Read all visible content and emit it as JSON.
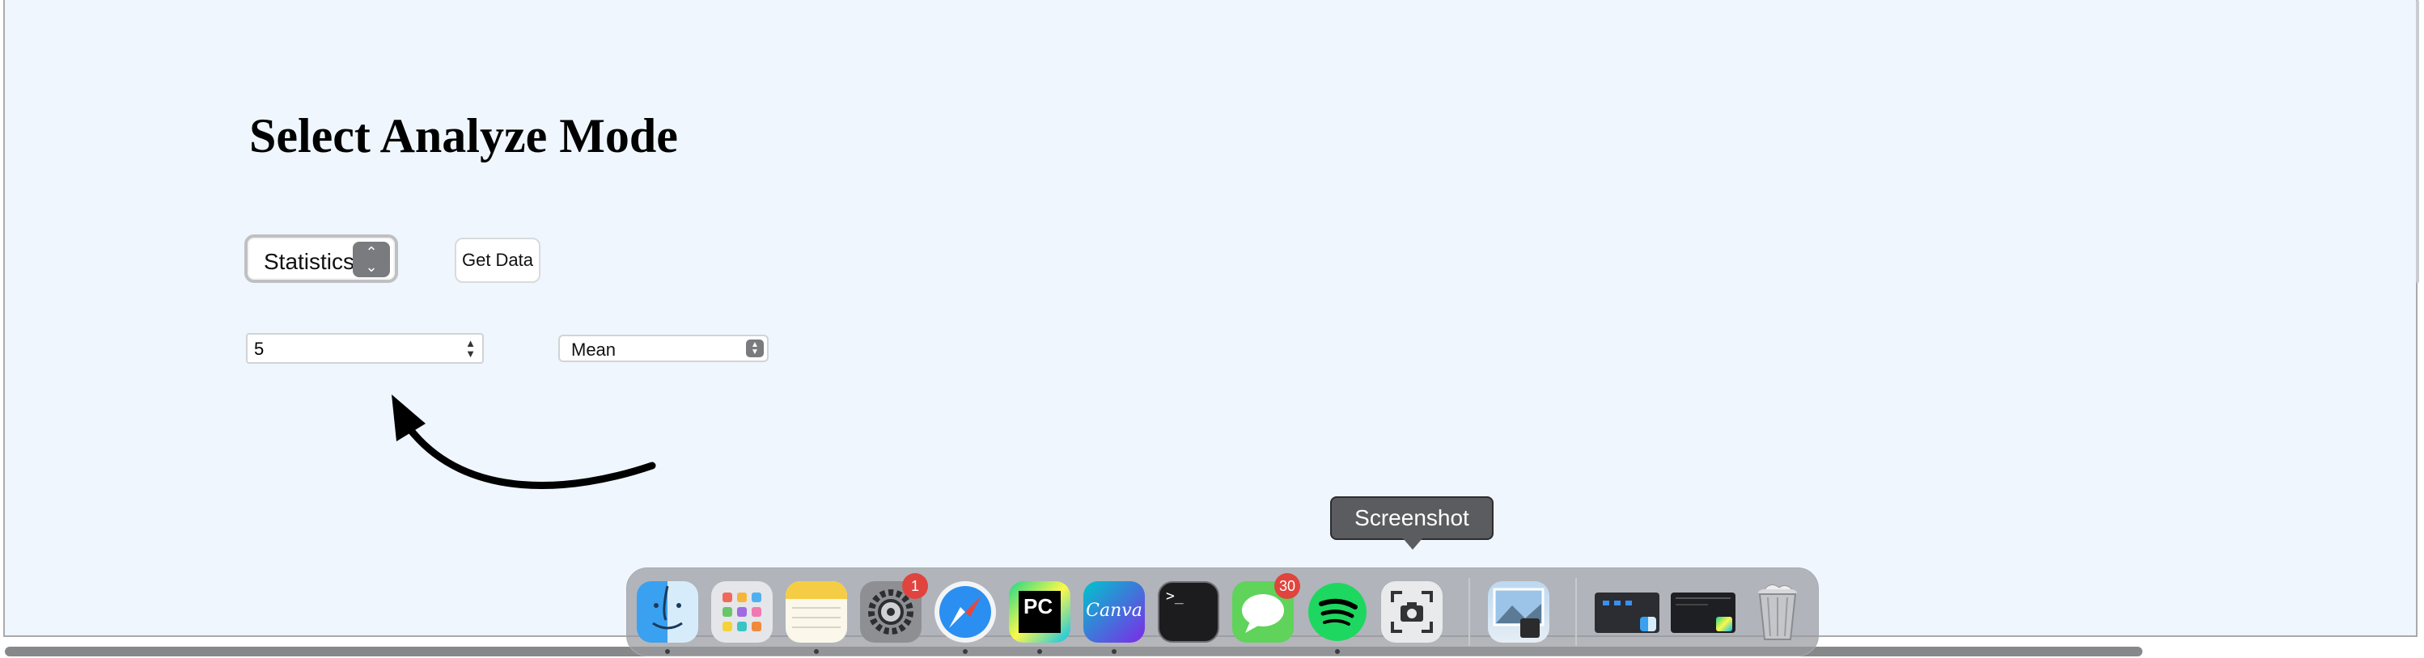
{
  "page": {
    "title": "Select Analyze Mode",
    "mode_select": {
      "value": "Statistics"
    },
    "get_data_label": "Get Data",
    "number_input": {
      "value": "5"
    },
    "statistic_select": {
      "value": "Mean"
    }
  },
  "dock": {
    "tooltip": "Screenshot",
    "apps": [
      {
        "name": "Finder",
        "icon": "finder-icon",
        "running": true
      },
      {
        "name": "Launchpad",
        "icon": "launchpad-icon",
        "running": false
      },
      {
        "name": "Notes",
        "icon": "notes-icon",
        "running": true
      },
      {
        "name": "System Settings",
        "icon": "gear-icon",
        "badge": "1",
        "running": false
      },
      {
        "name": "Safari",
        "icon": "compass-icon",
        "running": true
      },
      {
        "name": "PyCharm",
        "icon": "pycharm-icon",
        "label": "PC",
        "running": true
      },
      {
        "name": "Canva",
        "icon": "canva-icon",
        "label": "Canva",
        "running": true
      },
      {
        "name": "Terminal",
        "icon": "terminal-icon",
        "label": ">_",
        "running": false
      },
      {
        "name": "Messages",
        "icon": "message-bubble-icon",
        "badge": "30",
        "running": false
      },
      {
        "name": "Spotify",
        "icon": "spotify-icon",
        "running": true
      },
      {
        "name": "Screenshot",
        "icon": "camera-icon",
        "running": false
      },
      {
        "name": "Preview",
        "icon": "preview-icon",
        "running": false
      }
    ],
    "trash": {
      "name": "Trash",
      "icon": "trash-icon"
    }
  },
  "colors": {
    "page_bg": "#eff6fd",
    "badge": "#e0443e",
    "spotify": "#1ed760"
  }
}
